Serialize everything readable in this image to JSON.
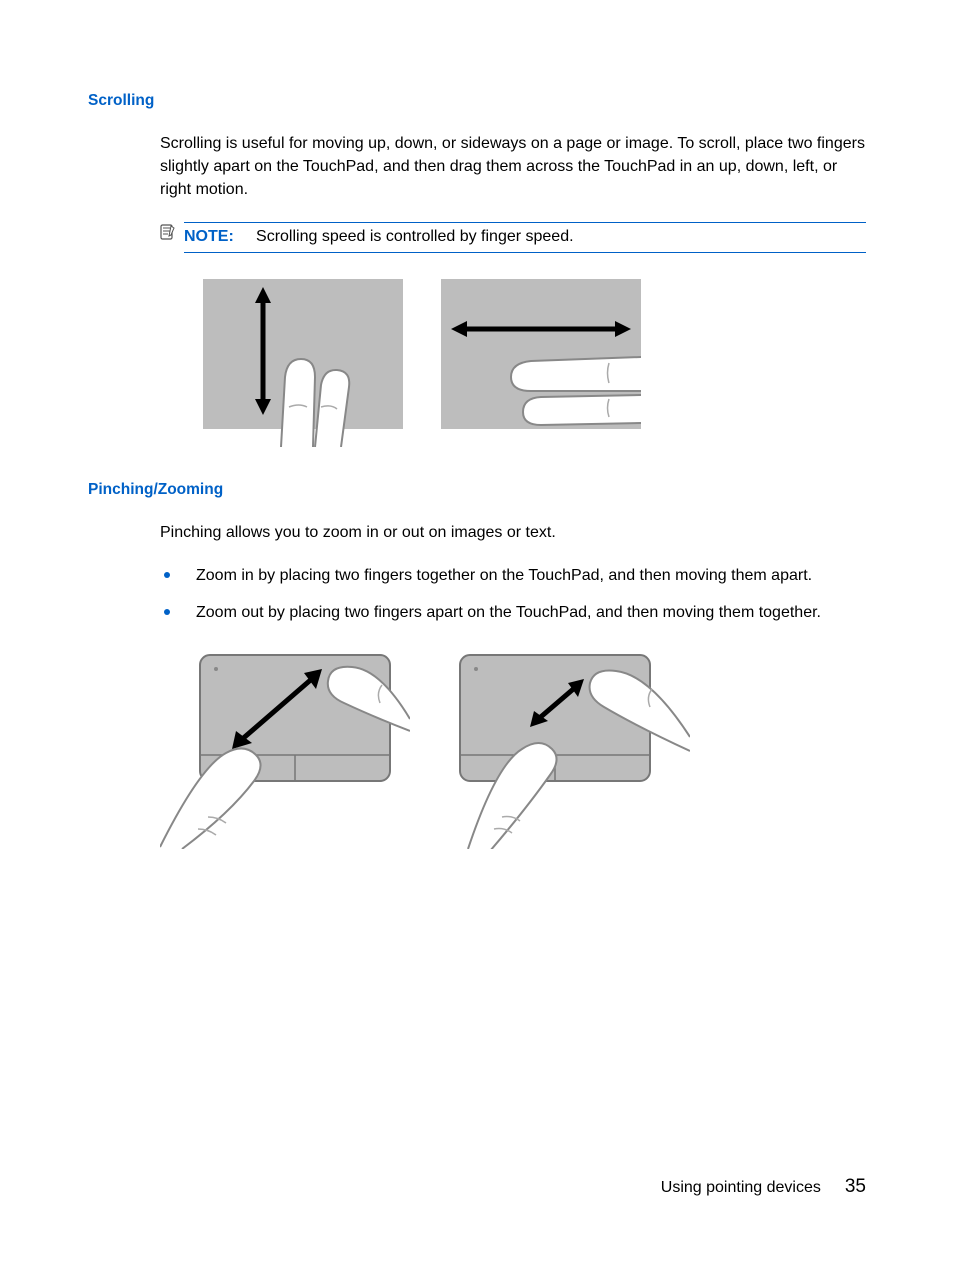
{
  "section1": {
    "heading": "Scrolling",
    "para": "Scrolling is useful for moving up, down, or sideways on a page or image. To scroll, place two fingers slightly apart on the TouchPad, and then drag them across the TouchPad in an up, down, left, or right motion.",
    "note_label": "NOTE:",
    "note_text": "Scrolling speed is controlled by finger speed."
  },
  "section2": {
    "heading": "Pinching/Zooming",
    "para": "Pinching allows you to zoom in or out on images or text.",
    "bullets": [
      "Zoom in by placing two fingers together on the TouchPad, and then moving them apart.",
      "Zoom out by placing two fingers apart on the TouchPad, and then moving them together."
    ]
  },
  "footer": {
    "section": "Using pointing devices",
    "page": "35"
  }
}
